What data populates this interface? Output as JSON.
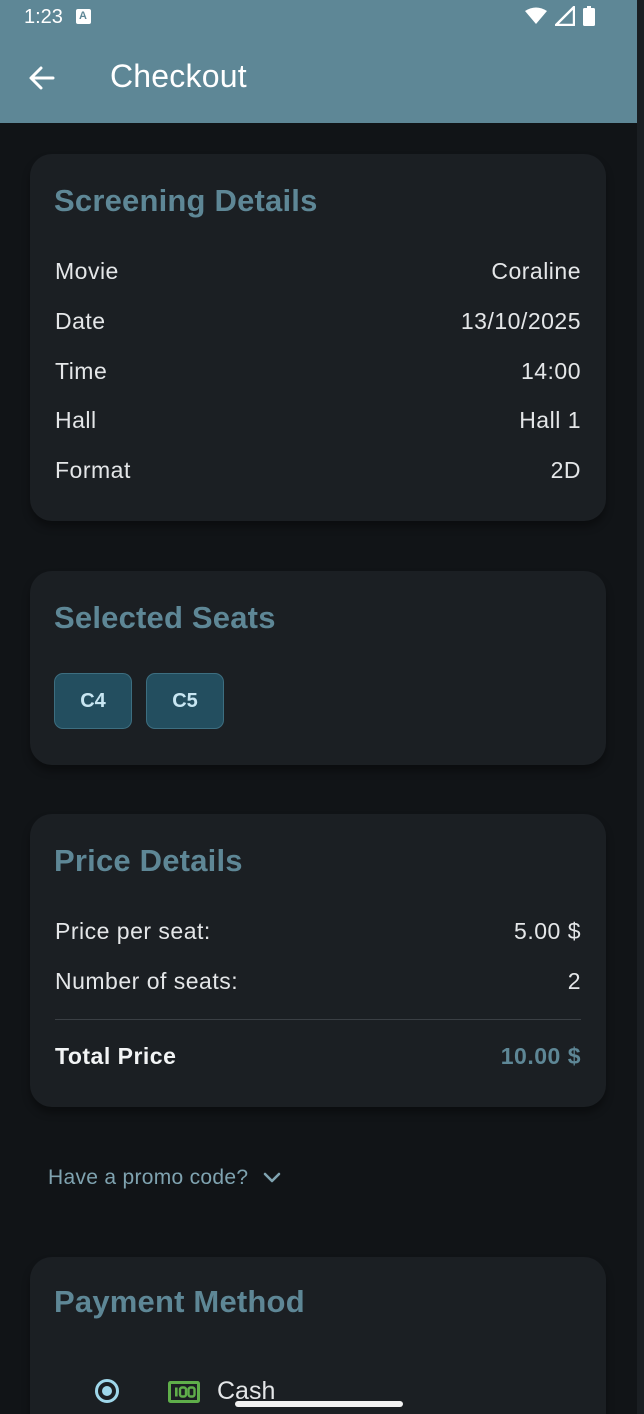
{
  "status_bar": {
    "time": "1:23"
  },
  "app_bar": {
    "title": "Checkout"
  },
  "screening": {
    "title": "Screening Details",
    "rows": [
      {
        "label": "Movie",
        "value": "Coraline"
      },
      {
        "label": "Date",
        "value": "13/10/2025"
      },
      {
        "label": "Time",
        "value": "14:00"
      },
      {
        "label": "Hall",
        "value": "Hall 1"
      },
      {
        "label": "Format",
        "value": "2D"
      }
    ]
  },
  "seats": {
    "title": "Selected Seats",
    "items": [
      "C4",
      "C5"
    ]
  },
  "price": {
    "title": "Price Details",
    "rows": [
      {
        "label": "Price per seat:",
        "value": "5.00 $"
      },
      {
        "label": "Number of seats:",
        "value": "2"
      }
    ],
    "total_label": "Total Price",
    "total_value": "10.00 $"
  },
  "promo": {
    "label": "Have a promo code?"
  },
  "payment": {
    "title": "Payment Method",
    "options": [
      {
        "label": "Cash",
        "icon": "cash-icon",
        "selected": true
      }
    ]
  },
  "colors": {
    "app_bar": "#5e8796",
    "background": "#111417",
    "card": "#1b1f23",
    "accent": "#5e8796",
    "chip": "#234e5f"
  }
}
